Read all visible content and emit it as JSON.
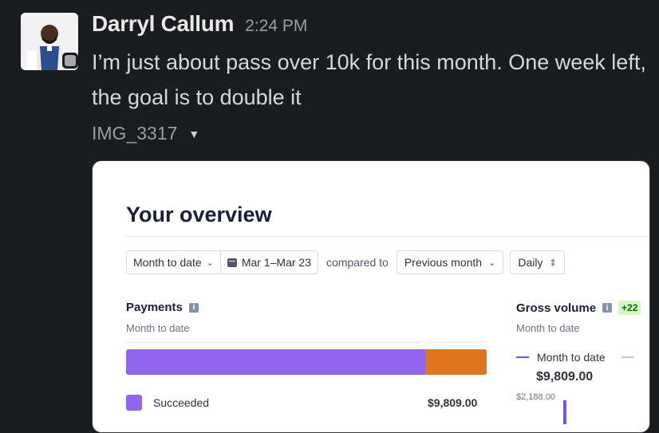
{
  "message": {
    "sender": "Darryl Callum",
    "time": "2:24 PM",
    "text": "I’m just about pass over 10k for this month. One week left, the goal is to double it",
    "attachment_name": "IMG_3317"
  },
  "overview": {
    "title": "Your overview",
    "filters": {
      "range": "Month to date",
      "dates": "Mar 1–Mar 23",
      "compared_to_label": "compared to",
      "compare": "Previous month",
      "interval": "Daily"
    },
    "payments": {
      "title": "Payments",
      "subtitle": "Month to date",
      "succeeded_fraction": 0.83,
      "succeeded_label": "Succeeded",
      "succeeded_value": "$9,809.00",
      "colors": {
        "succeeded": "#8f64ef",
        "other": "#e0761f"
      }
    },
    "gross_volume": {
      "title": "Gross volume",
      "badge": "+22",
      "subtitle": "Month to date",
      "legend_label": "Month to date",
      "value": "$9,809.00",
      "axis_label": "$2,188.00"
    }
  }
}
